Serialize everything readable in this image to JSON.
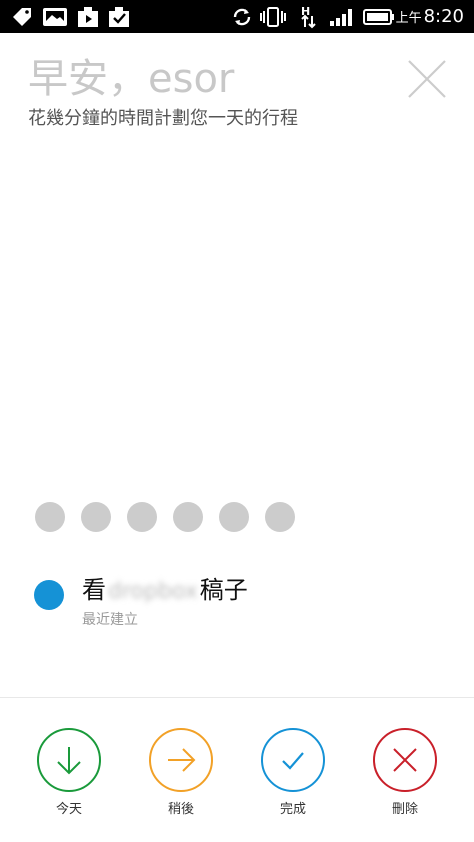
{
  "status_bar": {
    "ampm": "上午",
    "time": "8:20"
  },
  "header": {
    "greeting": "早安，esor",
    "subtitle": "花幾分鐘的時間計劃您一天的行程"
  },
  "task": {
    "title_prefix": "看",
    "title_blurred": "dropbox",
    "title_suffix": "稿子",
    "meta": "最近建立"
  },
  "actions": {
    "today": {
      "label": "今天",
      "color": "#1a9a3b"
    },
    "later": {
      "label": "稍後",
      "color": "#f2a127"
    },
    "done": {
      "label": "完成",
      "color": "#1592d6"
    },
    "delete": {
      "label": "刪除",
      "color": "#c9202a"
    }
  },
  "colors": {
    "task_bullet": "#1592d6",
    "dot_inactive": "#cccccc"
  }
}
